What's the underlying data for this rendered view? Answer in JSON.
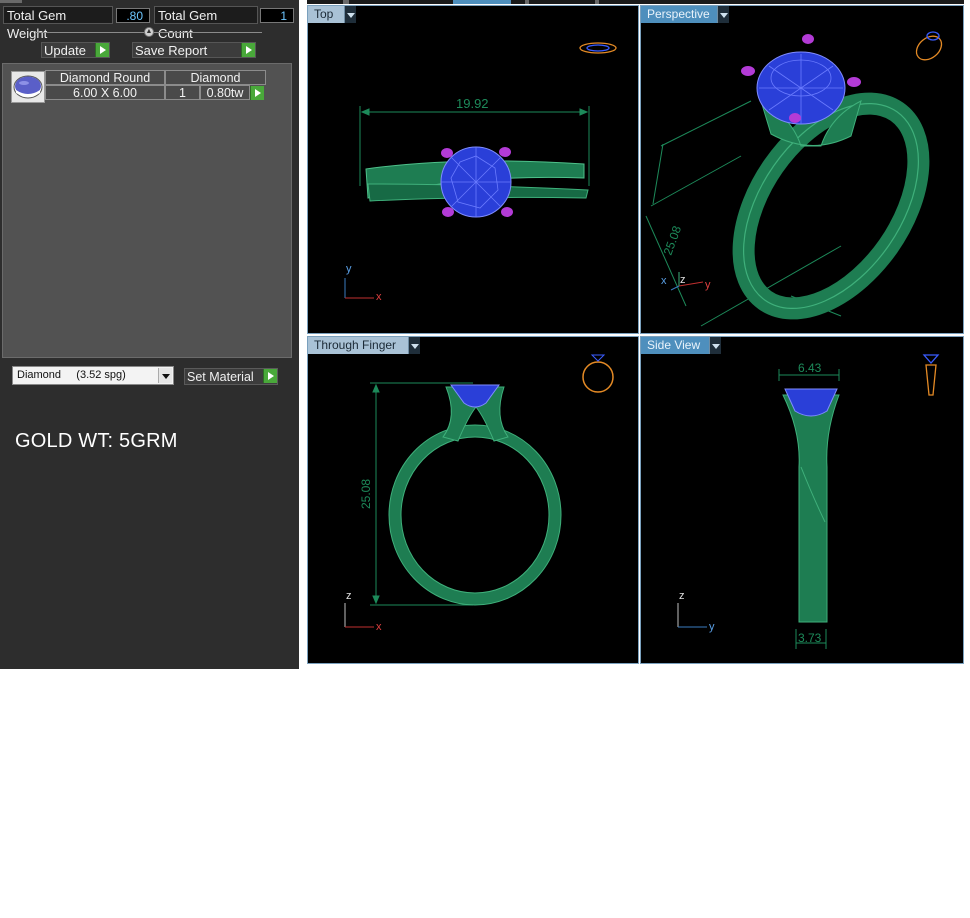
{
  "stats": {
    "total_gem_weight_label": "Total Gem Weight",
    "total_gem_weight_value": ".80",
    "total_gem_count_label": "Total Gem Count",
    "total_gem_count_value": "1"
  },
  "buttons": {
    "update_label": "Update",
    "save_report_label": "Save Report",
    "set_material_label": "Set Material"
  },
  "gem_table": {
    "row": {
      "name": "Diamond Round",
      "size": "6.00 X 6.00",
      "type": "Diamond",
      "count": "1",
      "weight": "0.80tw"
    }
  },
  "material": {
    "selected": "Diamond     (3.52 spg)"
  },
  "note": "GOLD WT: 5GRM",
  "viewports": {
    "top": {
      "label": "Top",
      "dimension": "19.92",
      "axis_vertical": "y",
      "axis_horizontal": "x"
    },
    "perspective": {
      "label": "Perspective",
      "dimension": "25.08",
      "axis_left": "x",
      "axis_up": "z",
      "axis_right": "y"
    },
    "through_finger": {
      "label": "Through Finger",
      "dimension": "25.08",
      "axis_vertical": "z",
      "axis_horizontal": "x"
    },
    "side": {
      "label": "Side View",
      "dimension_top": "6.43",
      "dimension_bottom": "3.73",
      "axis_vertical": "z",
      "axis_horizontal": "y"
    }
  },
  "colors": {
    "panel_bg": "#2d2d2d",
    "viewport_bg": "#000000",
    "metal": "#1d8a5a",
    "gem": "#2a3fd8",
    "prong": "#b33bd6",
    "accent_green": "#49a83a",
    "label_blue": "#a9c2d6"
  }
}
